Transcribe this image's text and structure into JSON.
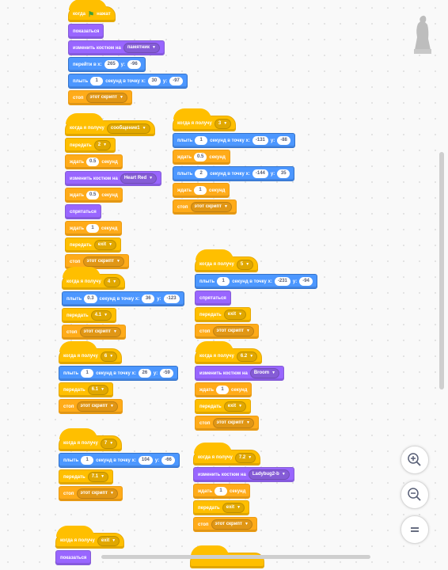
{
  "workspace": {
    "scripts": [
      {
        "blocks": [
          {
            "cat": "events",
            "hat": true,
            "parts": [
              {
                "t": "когда"
              },
              {
                "flag": true
              },
              {
                "t": "нажат"
              }
            ]
          },
          {
            "cat": "looks",
            "parts": [
              {
                "t": "показаться"
              }
            ]
          },
          {
            "cat": "looks",
            "parts": [
              {
                "t": "изменить костюм на"
              },
              {
                "dd": "памятник"
              }
            ]
          },
          {
            "cat": "motion",
            "parts": [
              {
                "t": "перейти в x:"
              },
              {
                "in": "265"
              },
              {
                "t": "y:"
              },
              {
                "in": "-96"
              }
            ]
          },
          {
            "cat": "motion",
            "parts": [
              {
                "t": "плыть"
              },
              {
                "in": "1"
              },
              {
                "t": "секунд в точку x:"
              },
              {
                "in": "30"
              },
              {
                "t": "y:"
              },
              {
                "in": "-97"
              }
            ]
          },
          {
            "cat": "control",
            "parts": [
              {
                "t": "стоп"
              },
              {
                "dd": "этот скрипт"
              }
            ]
          }
        ]
      },
      {
        "blocks": [
          {
            "cat": "events",
            "hat": true,
            "parts": [
              {
                "t": "когда я получу"
              },
              {
                "dd": "сообщение1"
              }
            ]
          },
          {
            "cat": "events",
            "parts": [
              {
                "t": "передать"
              },
              {
                "dd": "2"
              }
            ]
          },
          {
            "cat": "control",
            "parts": [
              {
                "t": "ждать"
              },
              {
                "in": "0.5"
              },
              {
                "t": "секунд"
              }
            ]
          },
          {
            "cat": "looks",
            "parts": [
              {
                "t": "изменить костюм на"
              },
              {
                "dd": "Heart Red"
              }
            ]
          },
          {
            "cat": "control",
            "parts": [
              {
                "t": "ждать"
              },
              {
                "in": "0.5"
              },
              {
                "t": "секунд"
              }
            ]
          },
          {
            "cat": "looks",
            "parts": [
              {
                "t": "спрятаться"
              }
            ]
          },
          {
            "cat": "control",
            "parts": [
              {
                "t": "ждать"
              },
              {
                "in": "1"
              },
              {
                "t": "секунд"
              }
            ]
          },
          {
            "cat": "events",
            "parts": [
              {
                "t": "передать"
              },
              {
                "dd": "exit"
              }
            ]
          },
          {
            "cat": "control",
            "parts": [
              {
                "t": "стоп"
              },
              {
                "dd": "этот скрипт"
              }
            ]
          }
        ]
      },
      {
        "blocks": [
          {
            "cat": "events",
            "hat": true,
            "parts": [
              {
                "t": "когда я получу"
              },
              {
                "dd": "3"
              }
            ]
          },
          {
            "cat": "motion",
            "parts": [
              {
                "t": "плыть"
              },
              {
                "in": "1"
              },
              {
                "t": "секунд в точку x:"
              },
              {
                "in": "-131"
              },
              {
                "t": "y:"
              },
              {
                "in": "-88"
              }
            ]
          },
          {
            "cat": "control",
            "parts": [
              {
                "t": "ждать"
              },
              {
                "in": "0.5"
              },
              {
                "t": "секунд"
              }
            ]
          },
          {
            "cat": "motion",
            "parts": [
              {
                "t": "плыть"
              },
              {
                "in": "2"
              },
              {
                "t": "секунд в точку x:"
              },
              {
                "in": "-144"
              },
              {
                "t": "y:"
              },
              {
                "in": "35"
              }
            ]
          },
          {
            "cat": "control",
            "parts": [
              {
                "t": "ждать"
              },
              {
                "in": "1"
              },
              {
                "t": "секунд"
              }
            ]
          },
          {
            "cat": "control",
            "parts": [
              {
                "t": "стоп"
              },
              {
                "dd": "этот скрипт"
              }
            ]
          }
        ]
      },
      {
        "blocks": [
          {
            "cat": "events",
            "hat": true,
            "parts": [
              {
                "t": "когда я получу"
              },
              {
                "dd": "4"
              }
            ]
          },
          {
            "cat": "motion",
            "parts": [
              {
                "t": "плыть"
              },
              {
                "in": "0.3"
              },
              {
                "t": "секунд в точку x:"
              },
              {
                "in": "36"
              },
              {
                "t": "y:"
              },
              {
                "in": "-123"
              }
            ]
          },
          {
            "cat": "events",
            "parts": [
              {
                "t": "передать"
              },
              {
                "dd": "4.1"
              }
            ]
          },
          {
            "cat": "control",
            "parts": [
              {
                "t": "стоп"
              },
              {
                "dd": "этот скрипт"
              }
            ]
          }
        ]
      },
      {
        "blocks": [
          {
            "cat": "events",
            "hat": true,
            "parts": [
              {
                "t": "когда я получу"
              },
              {
                "dd": "5"
              }
            ]
          },
          {
            "cat": "motion",
            "parts": [
              {
                "t": "плыть"
              },
              {
                "in": "1"
              },
              {
                "t": "секунд в точку x:"
              },
              {
                "in": "-231"
              },
              {
                "t": "y:"
              },
              {
                "in": "-94"
              }
            ]
          },
          {
            "cat": "looks",
            "parts": [
              {
                "t": "спрятаться"
              }
            ]
          },
          {
            "cat": "events",
            "parts": [
              {
                "t": "передать"
              },
              {
                "dd": "exit"
              }
            ]
          },
          {
            "cat": "control",
            "parts": [
              {
                "t": "стоп"
              },
              {
                "dd": "этот скрипт"
              }
            ]
          }
        ]
      },
      {
        "blocks": [
          {
            "cat": "events",
            "hat": true,
            "parts": [
              {
                "t": "когда я получу"
              },
              {
                "dd": "6"
              }
            ]
          },
          {
            "cat": "motion",
            "parts": [
              {
                "t": "плыть"
              },
              {
                "in": "1"
              },
              {
                "t": "секунд в точку x:"
              },
              {
                "in": "26"
              },
              {
                "t": "y:"
              },
              {
                "in": "-59"
              }
            ]
          },
          {
            "cat": "events",
            "parts": [
              {
                "t": "передать"
              },
              {
                "dd": "6.1"
              }
            ]
          },
          {
            "cat": "control",
            "parts": [
              {
                "t": "стоп"
              },
              {
                "dd": "этот скрипт"
              }
            ]
          }
        ]
      },
      {
        "blocks": [
          {
            "cat": "events",
            "hat": true,
            "parts": [
              {
                "t": "когда я получу"
              },
              {
                "dd": "6.2"
              }
            ]
          },
          {
            "cat": "looks",
            "parts": [
              {
                "t": "изменить костюм на"
              },
              {
                "dd": "Broom"
              }
            ]
          },
          {
            "cat": "control",
            "parts": [
              {
                "t": "ждать"
              },
              {
                "in": "1"
              },
              {
                "t": "секунд"
              }
            ]
          },
          {
            "cat": "events",
            "parts": [
              {
                "t": "передать"
              },
              {
                "dd": "exit"
              }
            ]
          },
          {
            "cat": "control",
            "parts": [
              {
                "t": "стоп"
              },
              {
                "dd": "этот скрипт"
              }
            ]
          }
        ]
      },
      {
        "blocks": [
          {
            "cat": "events",
            "hat": true,
            "parts": [
              {
                "t": "когда я получу"
              },
              {
                "dd": "7"
              }
            ]
          },
          {
            "cat": "motion",
            "parts": [
              {
                "t": "плыть"
              },
              {
                "in": "1"
              },
              {
                "t": "секунд в точку x:"
              },
              {
                "in": "104"
              },
              {
                "t": "y:"
              },
              {
                "in": "-66"
              }
            ]
          },
          {
            "cat": "events",
            "parts": [
              {
                "t": "передать"
              },
              {
                "dd": "7.1"
              }
            ]
          },
          {
            "cat": "control",
            "parts": [
              {
                "t": "стоп"
              },
              {
                "dd": "этот скрипт"
              }
            ]
          }
        ]
      },
      {
        "blocks": [
          {
            "cat": "events",
            "hat": true,
            "parts": [
              {
                "t": "когда я получу"
              },
              {
                "dd": "7.2"
              }
            ]
          },
          {
            "cat": "looks",
            "parts": [
              {
                "t": "изменить костюм на"
              },
              {
                "dd": "Ladybug2-b"
              }
            ]
          },
          {
            "cat": "control",
            "parts": [
              {
                "t": "ждать"
              },
              {
                "in": "1"
              },
              {
                "t": "секунд"
              }
            ]
          },
          {
            "cat": "events",
            "parts": [
              {
                "t": "передать"
              },
              {
                "dd": "exit"
              }
            ]
          },
          {
            "cat": "control",
            "parts": [
              {
                "t": "стоп"
              },
              {
                "dd": "этот скрипт"
              }
            ]
          }
        ]
      },
      {
        "blocks": [
          {
            "cat": "events",
            "hat": true,
            "parts": [
              {
                "t": "когда я получу"
              },
              {
                "dd": "exit"
              }
            ]
          },
          {
            "cat": "looks",
            "parts": [
              {
                "t": "показаться"
              }
            ]
          }
        ]
      },
      {
        "blocks": [
          {
            "cat": "events",
            "hat": true,
            "parts": []
          }
        ]
      }
    ]
  },
  "zoom_controls": {
    "zoom_in": "+",
    "zoom_out": "−",
    "reset": "="
  },
  "colors": {
    "events": "#ffbf00",
    "control": "#ffab19",
    "looks": "#9966ff",
    "motion": "#4c97ff"
  }
}
